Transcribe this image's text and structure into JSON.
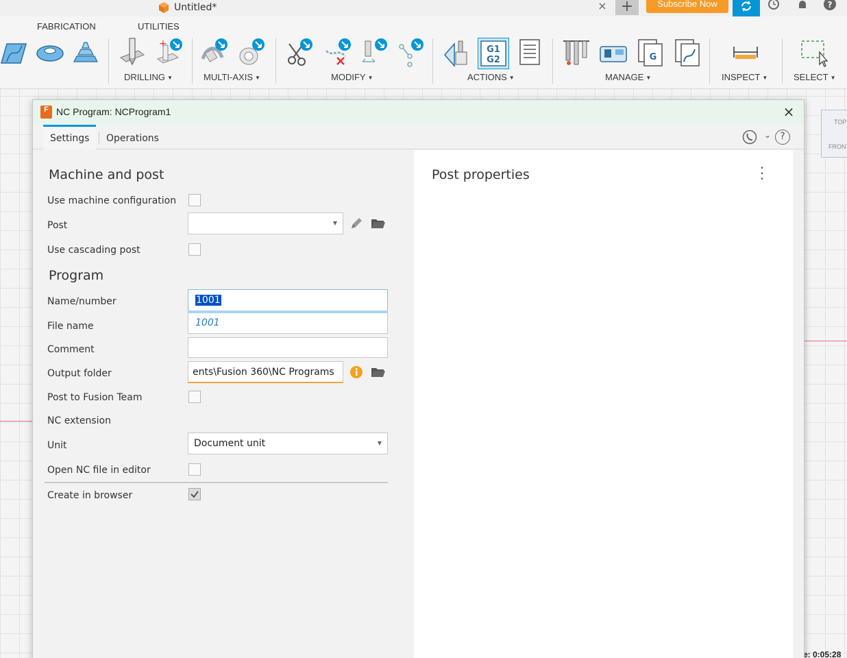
{
  "app": {
    "doc_title": "Untitled*",
    "tab_close": "×",
    "new_tab": "+",
    "subscribe_label": "Subscribe Now",
    "accent": "#0696d7",
    "subscribe_color": "#f79a26"
  },
  "ribbon": {
    "tabs": [
      "FABRICATION",
      "UTILITIES"
    ],
    "groups": [
      "DRILLING",
      "MULTI-AXIS",
      "MODIFY",
      "ACTIONS",
      "MANAGE",
      "INSPECT",
      "SELECT"
    ],
    "icons": [
      "surface-icon",
      "pocket-icon",
      "contour-icon",
      "drill-icon",
      "hole-recognition-icon",
      "multiaxis-icon",
      "rotary-icon",
      "cut-icon",
      "delete-icon",
      "tool-edit-icon",
      "pattern-icon",
      "simulate-icon",
      "post-process-icon",
      "setup-sheet-icon",
      "tool-library-icon",
      "machine-library-icon",
      "nc-program-icon",
      "template-icon",
      "measure-icon",
      "select-window-icon"
    ]
  },
  "canvas": {
    "viewcube_top": "TOP",
    "viewcube_front": "FRONT",
    "timer": "e: 0:05:28"
  },
  "dialog": {
    "title": "NC Program: NCProgram1",
    "logo_text": "F",
    "close": "×",
    "tabs": [
      "Settings",
      "Operations"
    ],
    "help": "?",
    "machine_post": {
      "heading": "Machine and post",
      "use_machine_config_label": "Use machine configuration",
      "use_machine_config_checked": false,
      "post_label": "Post",
      "post_value": "",
      "use_cascading_label": "Use cascading post",
      "use_cascading_checked": false
    },
    "program": {
      "heading": "Program",
      "name_label": "Name/number",
      "name_value": "1001",
      "autocomplete": "1001",
      "file_label": "File name",
      "comment_label": "Comment",
      "comment_value": "",
      "output_folder_label": "Output folder",
      "output_folder_value": "ents\\Fusion 360\\NC Programs",
      "post_team_label": "Post to Fusion Team",
      "post_team_checked": false,
      "nc_ext_label": "NC extension",
      "unit_label": "Unit",
      "unit_value": "Document unit",
      "open_nc_label": "Open NC file in editor",
      "open_nc_checked": false,
      "create_browser_label": "Create in browser",
      "create_browser_checked": true
    },
    "post_properties": {
      "heading": "Post properties"
    }
  }
}
